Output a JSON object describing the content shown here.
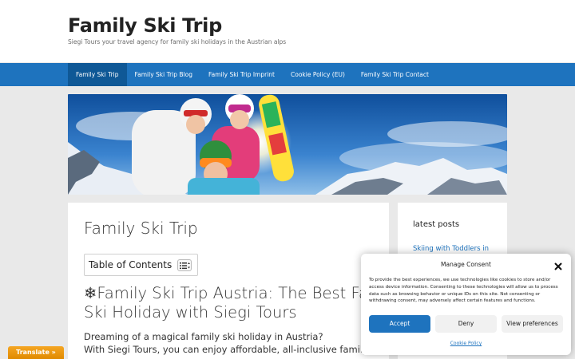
{
  "header": {
    "title": "Family Ski Trip",
    "tagline": "Siegi Tours your travel agency for family ski holidays in the Austrian alps"
  },
  "nav": {
    "items": [
      {
        "label": "Family Ski Trip"
      },
      {
        "label": "Family Ski Trip Blog"
      },
      {
        "label": "Family Ski Trip Imprint"
      },
      {
        "label": "Cookie Policy (EU)"
      },
      {
        "label": "Family Ski Trip Contact"
      }
    ],
    "active_index": 0
  },
  "main": {
    "page_title": "Family Ski Trip",
    "toc_label": "Table of Contents",
    "heading_line1": "❄Family Ski Trip Austria: The Best Fami",
    "heading_line2": "Ski Holiday with Siegi Tours",
    "intro_line1": "Dreaming of a magical family ski holiday in Austria?",
    "intro_line2": "With Siegi Tours, you can enjoy affordable, all-inclusive family ski trips in th"
  },
  "sidebar": {
    "title": "latest posts",
    "link": "Skiing with Toddlers in"
  },
  "consent": {
    "title": "Manage Consent",
    "text": "To provide the best experiences, we use technologies like cookies to store and/or access device information. Consenting to these technologies will allow us to process data such as browsing behavior or unique IDs on this site. Not consenting or withdrawing consent, may adversely affect certain features and functions.",
    "accept": "Accept",
    "deny": "Deny",
    "preferences": "View preferences",
    "policy_link": "Cookie Policy"
  },
  "translate": {
    "label": "Translate »"
  },
  "colors": {
    "accent": "#1e73be",
    "nav_active": "#0f5896",
    "page_bg": "#e9e9e9"
  }
}
